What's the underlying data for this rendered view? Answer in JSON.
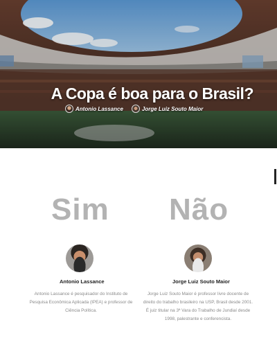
{
  "hero": {
    "title": "A Copa é boa para o Brasil?",
    "authors": [
      {
        "name": "Antonio Lassance"
      },
      {
        "name": "Jorge Luiz Souto Maior"
      }
    ]
  },
  "debate": {
    "yes_label": "Sim",
    "no_label": "Não"
  },
  "people": {
    "left": {
      "name": "Antonio Lassance",
      "bio": "Antonio Lassance é pesquisador do Instituto de Pesquisa Econômica Aplicada (IPEA) e professor de Ciência Política."
    },
    "right": {
      "name": "Jorge Luiz Souto Maior",
      "bio": "Jorge Luiz Souto Maior é professor livre docente de direito do trabalho brasileiro na USP, Brasil desde 2001. É juiz titular na 3ª Vara do Trabalho de Jundiaí desde 1998, palestrante e conferencista."
    }
  },
  "colors": {
    "vote_word": "#b3b3b3",
    "bio_text": "#8a8a8a"
  }
}
